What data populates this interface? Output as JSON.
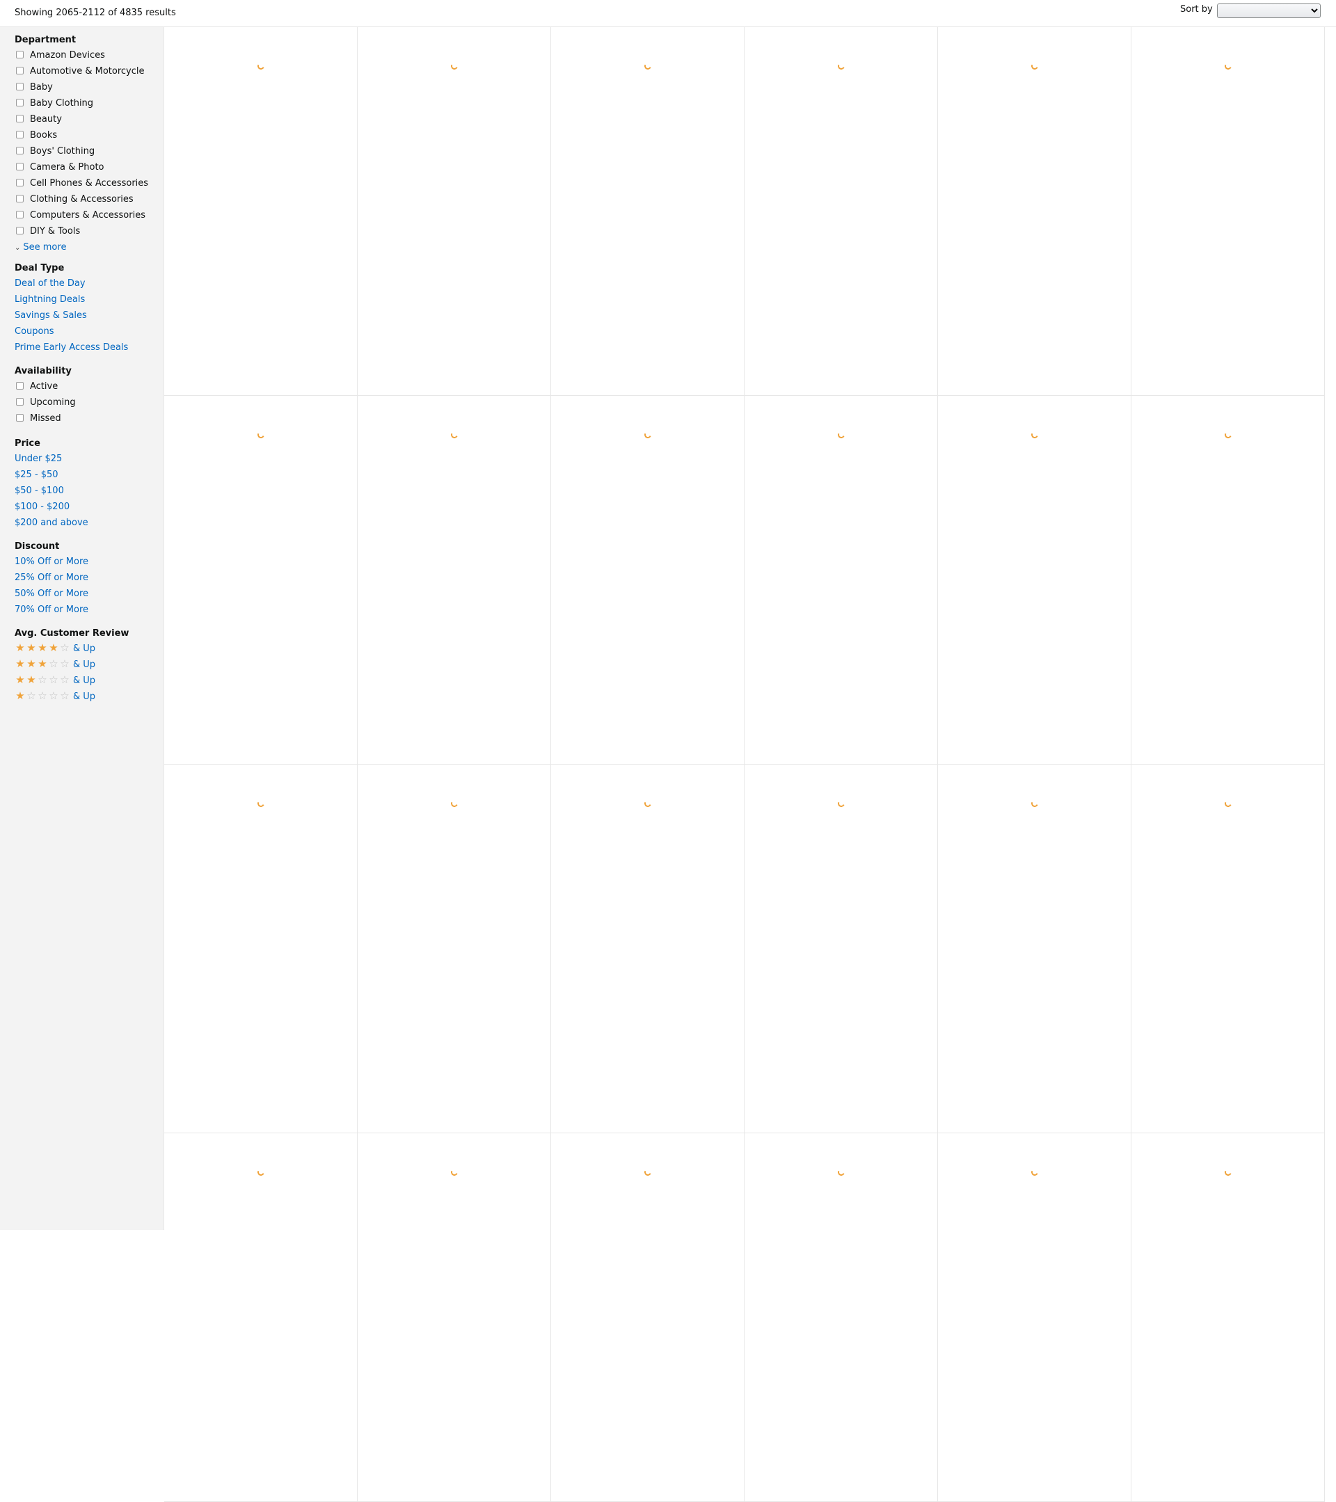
{
  "header": {
    "results_text": "Showing 2065-2112 of 4835 results",
    "sort_label": "Sort by",
    "sort_value": ""
  },
  "sidebar": {
    "department": {
      "title": "Department",
      "items": [
        "Amazon Devices",
        "Automotive & Motorcycle",
        "Baby",
        "Baby Clothing",
        "Beauty",
        "Books",
        "Boys' Clothing",
        "Camera & Photo",
        "Cell Phones & Accessories",
        "Clothing & Accessories",
        "Computers & Accessories",
        "DIY & Tools"
      ],
      "see_more": "See more"
    },
    "deal_type": {
      "title": "Deal Type",
      "items": [
        "Deal of the Day",
        "Lightning Deals",
        "Savings & Sales",
        "Coupons",
        "Prime Early Access Deals"
      ]
    },
    "availability": {
      "title": "Availability",
      "items": [
        "Active",
        "Upcoming",
        "Missed"
      ]
    },
    "price": {
      "title": "Price",
      "items": [
        "Under $25",
        "$25 - $50",
        "$50 - $100",
        "$100 - $200",
        "$200 and above"
      ]
    },
    "discount": {
      "title": "Discount",
      "items": [
        "10% Off or More",
        "25% Off or More",
        "50% Off or More",
        "70% Off or More"
      ]
    },
    "review": {
      "title": "Avg. Customer Review",
      "items": [
        {
          "stars": 4,
          "label": "& Up"
        },
        {
          "stars": 3,
          "label": "& Up"
        },
        {
          "stars": 2,
          "label": "& Up"
        },
        {
          "stars": 1,
          "label": "& Up"
        }
      ]
    }
  },
  "grid": {
    "columns": 6,
    "rows": 4,
    "tile_state": "loading"
  },
  "colors": {
    "link": "#0066c0",
    "star": "#f0a33a",
    "sidebar_bg": "#f3f3f3",
    "border": "#e7e7e7"
  }
}
